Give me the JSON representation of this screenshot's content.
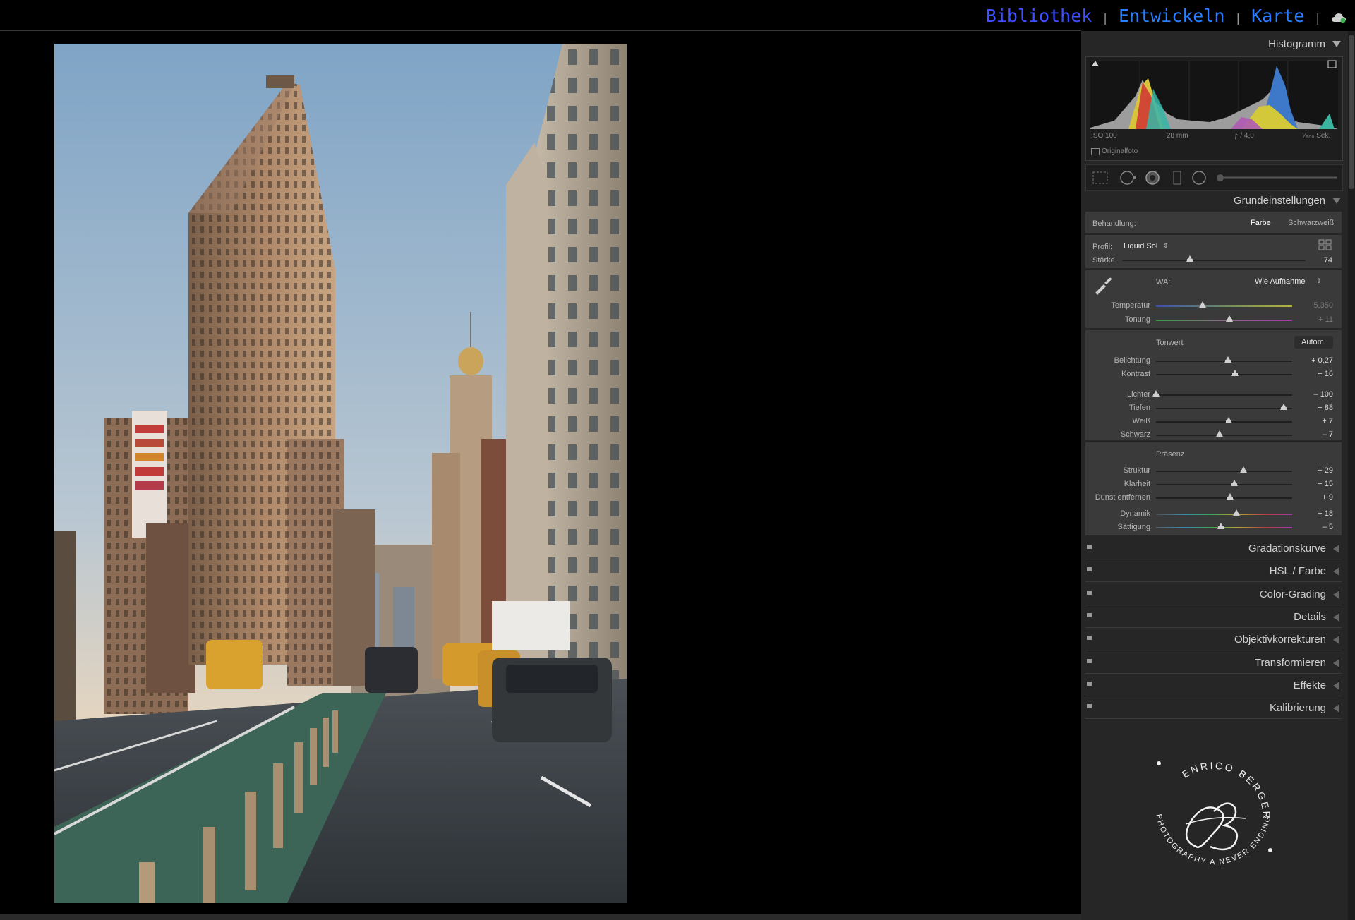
{
  "modules": {
    "library": "Bibliothek",
    "develop": "Entwickeln",
    "map": "Karte",
    "separator": "|"
  },
  "histogram": {
    "title": "Histogramm",
    "iso": "ISO 100",
    "focal": "28 mm",
    "aperture": "ƒ / 4,0",
    "shutter": "¹⁄₈₀₀ Sek.",
    "original": "Originalfoto"
  },
  "basic": {
    "title": "Grundeinstellungen",
    "treatment_label": "Behandlung:",
    "treatment_color": "Farbe",
    "treatment_bw": "Schwarzweiß",
    "profile_label": "Profil:",
    "profile_value": "Liquid Sol",
    "amount_label": "Stärke",
    "amount_value": "74",
    "amount_level": 0.37,
    "wb_label": "WA:",
    "wb_value": "Wie Aufnahme",
    "tone_label": "Tonwert",
    "auto_label": "Autom.",
    "presence_label": "Präsenz",
    "sliders_wb": [
      {
        "label": "Temperatur",
        "value": "5.350",
        "level": 0.34,
        "dim": true,
        "track": "temp"
      },
      {
        "label": "Tonung",
        "value": "+ 11",
        "level": 0.54,
        "dim": true,
        "track": "tint"
      }
    ],
    "sliders_tone": [
      {
        "label": "Belichtung",
        "value": "+ 0,27",
        "level": 0.527
      },
      {
        "label": "Kontrast",
        "value": "+ 16",
        "level": 0.58
      }
    ],
    "sliders_tone2": [
      {
        "label": "Lichter",
        "value": "– 100",
        "level": 0.0
      },
      {
        "label": "Tiefen",
        "value": "+ 88",
        "level": 0.94
      },
      {
        "label": "Weiß",
        "value": "+ 7",
        "level": 0.535
      },
      {
        "label": "Schwarz",
        "value": "– 7",
        "level": 0.465
      }
    ],
    "sliders_presence": [
      {
        "label": "Struktur",
        "value": "+ 29",
        "level": 0.645
      },
      {
        "label": "Klarheit",
        "value": "+ 15",
        "level": 0.575
      },
      {
        "label": "Dunst entfernen",
        "value": "+ 9",
        "level": 0.545
      }
    ],
    "sliders_color": [
      {
        "label": "Dynamik",
        "value": "+ 18",
        "level": 0.59,
        "track": "vib"
      },
      {
        "label": "Sättigung",
        "value": "– 5",
        "level": 0.475,
        "track": "sat"
      }
    ]
  },
  "panels": [
    {
      "title": "Gradationskurve"
    },
    {
      "title": "HSL / Farbe"
    },
    {
      "title": "Color-Grading"
    },
    {
      "title": "Details"
    },
    {
      "title": "Objektivkorrekturen"
    },
    {
      "title": "Transformieren"
    },
    {
      "title": "Effekte"
    },
    {
      "title": "Kalibrierung"
    }
  ],
  "colors": {
    "module_library": "#3d4fff",
    "module_active": "#2a7fff",
    "panel_bg": "#262626",
    "section_bg": "#3a3a3a"
  }
}
